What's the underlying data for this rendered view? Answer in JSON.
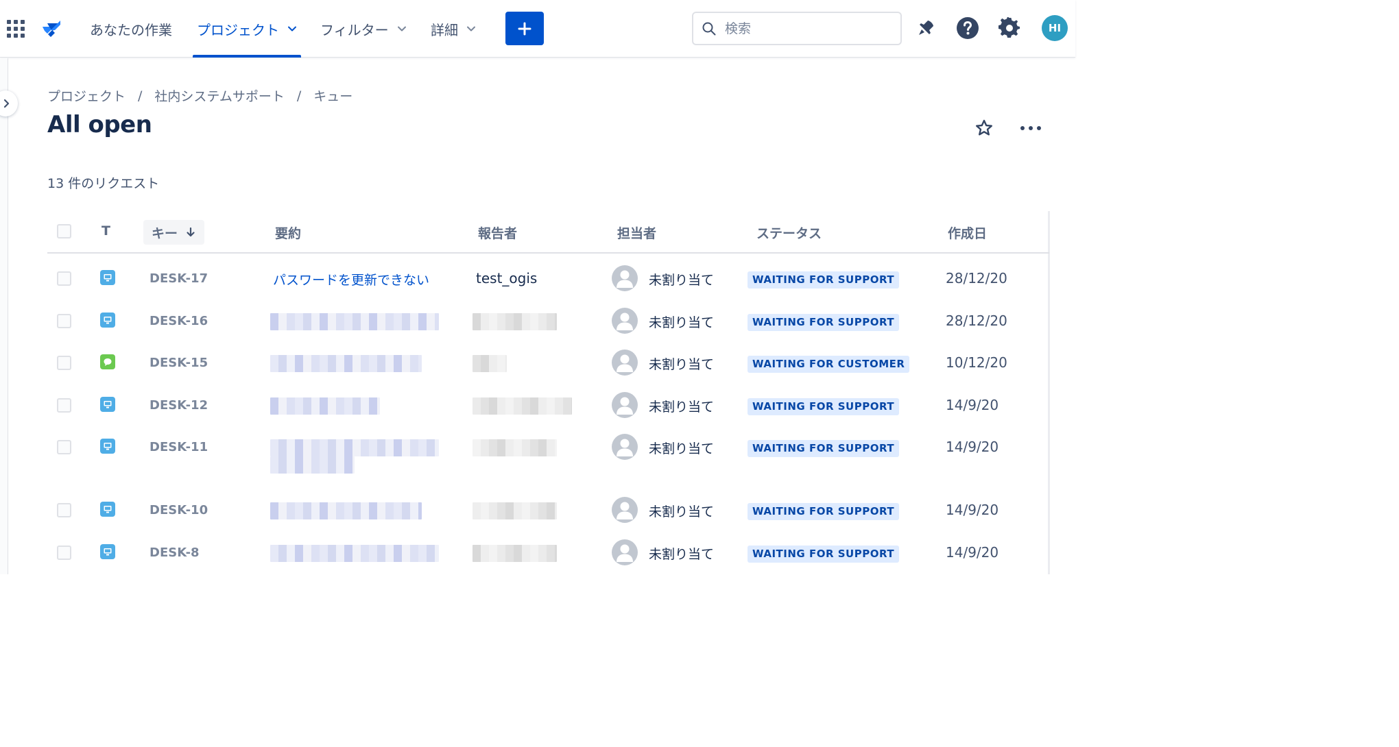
{
  "nav": {
    "items": [
      {
        "label": "あなたの作業",
        "active": false,
        "dropdown": false
      },
      {
        "label": "プロジェクト",
        "active": true,
        "dropdown": true
      },
      {
        "label": "フィルター",
        "active": false,
        "dropdown": true
      },
      {
        "label": "詳細",
        "active": false,
        "dropdown": true
      }
    ],
    "create_icon": "plus-icon",
    "search_placeholder": "検索",
    "icons": [
      "notifications-icon",
      "help-icon",
      "settings-icon"
    ],
    "avatar_initials": "HI"
  },
  "breadcrumb": [
    "プロジェクト",
    "社内システムサポート",
    "キュー"
  ],
  "breadcrumb_separator": "/",
  "page_title": "All open",
  "request_count": "13 件のリクエスト",
  "table": {
    "columns": {
      "type": "T",
      "key": "キー",
      "summary": "要約",
      "reporter": "報告者",
      "assignee": "担当者",
      "status": "ステータス",
      "created": "作成日"
    },
    "sort": {
      "column": "key",
      "direction": "descending"
    },
    "rows": [
      {
        "type": "service-request-icon",
        "key": "DESK-17",
        "summary": "パスワードを更新できない",
        "reporter": "test_ogis",
        "assignee": "未割り当て",
        "status": "WAITING FOR SUPPORT",
        "created": "28/12/20"
      },
      {
        "type": "service-request-icon",
        "key": "DESK-16",
        "summary": "",
        "reporter": "",
        "assignee": "未割り当て",
        "status": "WAITING FOR SUPPORT",
        "created": "28/12/20"
      },
      {
        "type": "question-icon",
        "key": "DESK-15",
        "summary": "",
        "reporter": "",
        "assignee": "未割り当て",
        "status": "WAITING FOR CUSTOMER",
        "created": "10/12/20"
      },
      {
        "type": "service-request-icon",
        "key": "DESK-12",
        "summary": "",
        "reporter": "",
        "assignee": "未割り当て",
        "status": "WAITING FOR SUPPORT",
        "created": "14/9/20"
      },
      {
        "type": "service-request-icon",
        "key": "DESK-11",
        "summary": "",
        "reporter": "",
        "assignee": "未割り当て",
        "status": "WAITING FOR SUPPORT",
        "created": "14/9/20"
      },
      {
        "type": "service-request-icon",
        "key": "DESK-10",
        "summary": "",
        "reporter": "",
        "assignee": "未割り当て",
        "status": "WAITING FOR SUPPORT",
        "created": "14/9/20"
      },
      {
        "type": "service-request-icon",
        "key": "DESK-8",
        "summary": "",
        "reporter": "",
        "assignee": "未割り当て",
        "status": "WAITING FOR SUPPORT",
        "created": "14/9/20"
      }
    ]
  },
  "colors": {
    "brand": "#0052cc",
    "lozenge_bg": "#deebff",
    "lozenge_text": "#0747a6",
    "service_request_icon": "#4fade6",
    "question_icon": "#6bc950"
  }
}
